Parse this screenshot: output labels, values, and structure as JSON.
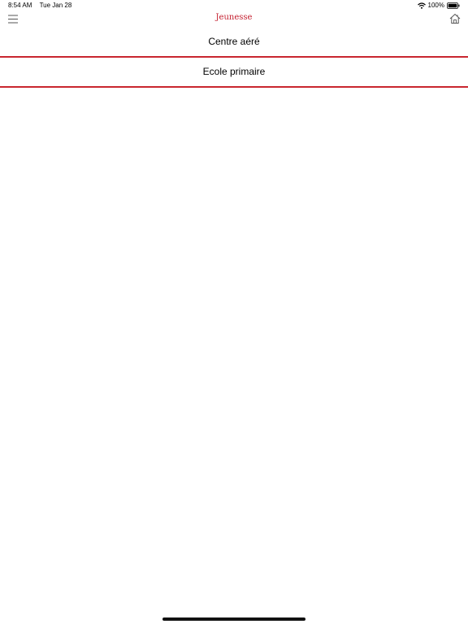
{
  "status_bar": {
    "time": "8:54 AM",
    "date": "Tue Jan 28",
    "battery": "100%",
    "icons": [
      "wifi-icon",
      "battery-icon"
    ]
  },
  "nav": {
    "title": "Jeunesse",
    "left_icon": "hamburger-menu-icon",
    "right_icon": "home-icon"
  },
  "menu_items": [
    {
      "label": "Centre aéré"
    },
    {
      "label": "Ecole primaire"
    }
  ],
  "colors": {
    "accent": "#c9262f",
    "title": "#c41e2e",
    "background": "#ffffff"
  }
}
